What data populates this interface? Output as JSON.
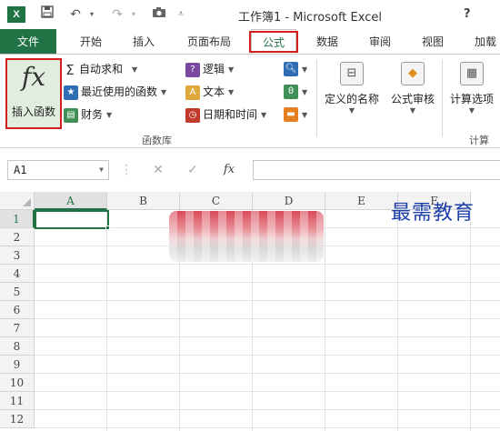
{
  "titlebar": {
    "title": "工作簿1 - Microsoft Excel",
    "app_logo": "X",
    "help": "?",
    "qat": {
      "save_icon": "save-icon",
      "undo_icon": "undo-icon",
      "redo_icon": "redo-icon",
      "camera_icon": "camera-icon",
      "customize_icon": "customize-qat-icon"
    }
  },
  "tabs": [
    {
      "label": "文件"
    },
    {
      "label": "开始"
    },
    {
      "label": "插入"
    },
    {
      "label": "页面布局"
    },
    {
      "label": "公式"
    },
    {
      "label": "数据"
    },
    {
      "label": "审阅"
    },
    {
      "label": "视图"
    },
    {
      "label": "加载"
    }
  ],
  "active_tab": "公式",
  "ribbon": {
    "insert_function": {
      "icon": "fx",
      "label": "插入函数"
    },
    "function_library": {
      "autosum": "自动求和",
      "recent": "最近使用的函数",
      "financial": "财务",
      "logical": "逻辑",
      "text": "文本",
      "datetime": "日期和时间",
      "group_label": "函数库"
    },
    "defined_names": "定义的名称",
    "formula_auditing": "公式审核",
    "calc_options": "计算选项",
    "calc_group_label": "计算"
  },
  "formula_bar": {
    "name_box": "A1",
    "cancel_glyph": "✕",
    "enter_glyph": "✓",
    "fx": "fx",
    "value": ""
  },
  "grid": {
    "columns": [
      "A",
      "B",
      "C",
      "D",
      "E",
      "F"
    ],
    "rows": [
      "1",
      "2",
      "3",
      "4",
      "5",
      "6",
      "7",
      "8",
      "9",
      "10",
      "11",
      "12"
    ],
    "selected_cell": "A1"
  },
  "watermark": "最需教育",
  "colors": {
    "excel_green": "#217346",
    "highlight_red": "#d21e1e",
    "watermark_blue": "#1c3fa8"
  }
}
